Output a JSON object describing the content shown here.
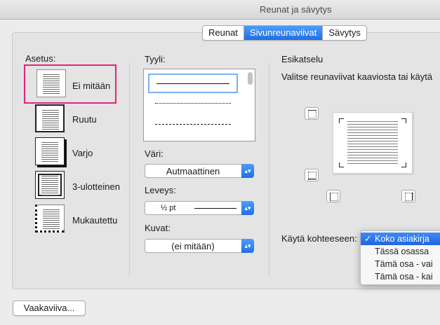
{
  "window": {
    "title": "Reunat ja sävytys"
  },
  "tabs": [
    {
      "label": "Reunat",
      "active": false
    },
    {
      "label": "Sivunreunaviivat",
      "active": true
    },
    {
      "label": "Sävytys",
      "active": false
    }
  ],
  "setting": {
    "heading": "Asetus:",
    "options": [
      {
        "label": "Ei mitään",
        "selected": true
      },
      {
        "label": "Ruutu",
        "selected": false
      },
      {
        "label": "Varjo",
        "selected": false
      },
      {
        "label": "3-ulotteinen",
        "selected": false
      },
      {
        "label": "Mukautettu",
        "selected": false
      }
    ]
  },
  "style": {
    "heading": "Tyyli:",
    "color_label": "Väri:",
    "color_value": "Autmaattinen",
    "width_label": "Leveys:",
    "width_value": "½ pt",
    "art_label": "Kuvat:",
    "art_value": "(ei mitään)"
  },
  "preview": {
    "heading": "Esikatselu",
    "instructions": "Valitse reunaviivat kaaviosta tai käytä"
  },
  "apply_to": {
    "label": "Käytä kohteeseen:",
    "options": [
      {
        "label": "Koko asiakirja",
        "selected": true
      },
      {
        "label": "Tässä osassa",
        "selected": false
      },
      {
        "label": "Tämä osa - vai",
        "selected": false
      },
      {
        "label": "Tämä osa - kai",
        "selected": false
      }
    ]
  },
  "footer": {
    "horizontal_line_button": "Vaakaviiva..."
  },
  "colors": {
    "accent": "#1f6fe5",
    "selection_ring": "#e0247e"
  }
}
